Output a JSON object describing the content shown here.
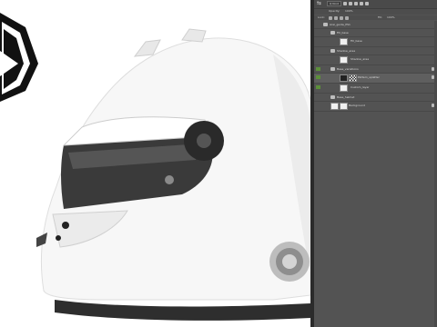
{
  "colors": {
    "panel_bg": "#535353",
    "canvas_bg": "#ffffff",
    "helmet_white": "#f7f7f7",
    "visor_dark": "#3a3a3a",
    "accent_green": "#5c8f3a"
  },
  "icons": {
    "panel_swap": "swap-icon",
    "layer_eye": "eye-icon",
    "layer_folder": "folder-icon",
    "layer_lock": "lock-icon"
  },
  "layers_panel": {
    "filter_kind": "Q Kind",
    "opacity_label": "Opacity:",
    "opacity_value": "100%",
    "lock_label": "Lock:",
    "fill_label": "Fill:",
    "fill_value": "100%",
    "layers": [
      {
        "name": "Arai_guide_PS1",
        "kind": "group"
      },
      {
        "name": "Fill_base",
        "kind": "group"
      },
      {
        "name": "Fill_base",
        "kind": "layer"
      },
      {
        "name": "Shadow_area",
        "kind": "group"
      },
      {
        "name": "Shadow_area",
        "kind": "layer"
      },
      {
        "name": "Base_variations",
        "kind": "group"
      },
      {
        "name": "Pattern_splatter",
        "kind": "layer"
      },
      {
        "name": "Custom_layer",
        "kind": "layer"
      },
      {
        "name": "Base_helmet",
        "kind": "group"
      },
      {
        "name": "Background",
        "kind": "layer"
      }
    ]
  }
}
